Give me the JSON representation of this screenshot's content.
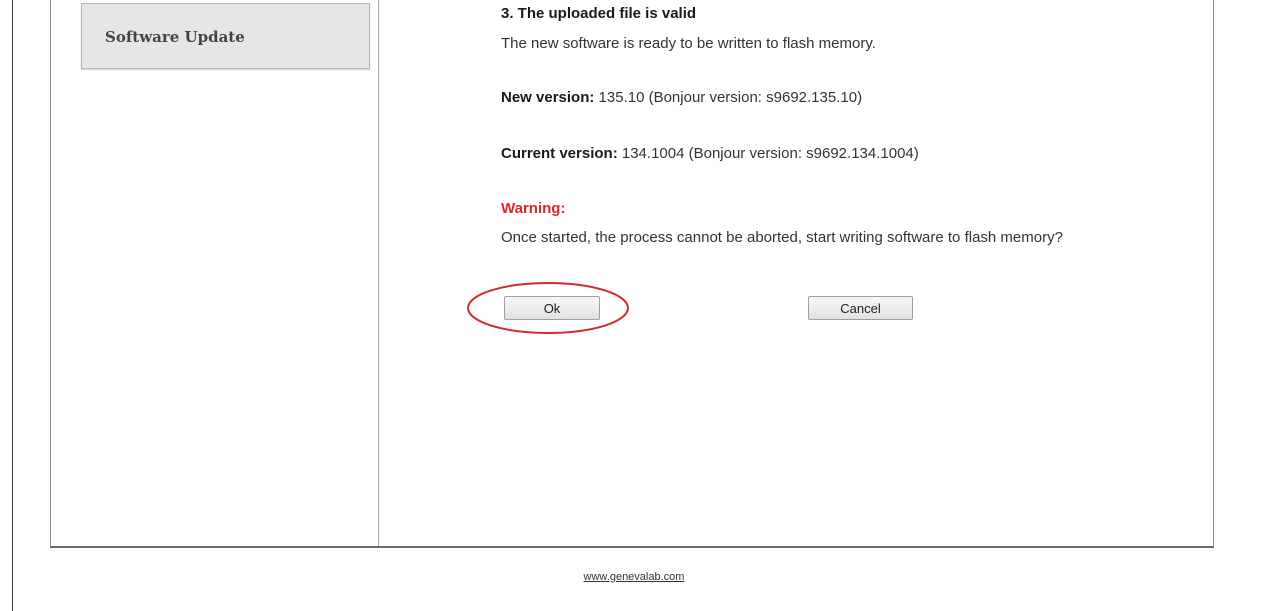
{
  "sidebar": {
    "items": [
      {
        "label": "Software Update"
      }
    ]
  },
  "main": {
    "step_title": "3. The uploaded file is valid",
    "ready_text": "The new software is ready to be written to flash memory.",
    "new_version": {
      "label": "New version:",
      "value": "135.10 (Bonjour version: s9692.135.10)"
    },
    "current_version": {
      "label": "Current version:",
      "value": "134.1004 (Bonjour version: s9692.134.1004)"
    },
    "warning": {
      "title": "Warning:",
      "body": "Once started, the process cannot be aborted, start writing software to flash memory?"
    },
    "buttons": {
      "ok": "Ok",
      "cancel": "Cancel"
    }
  },
  "annotation": {
    "highlight_color": "#d42a2a"
  },
  "footer": {
    "link": "www.genevalab.com"
  }
}
